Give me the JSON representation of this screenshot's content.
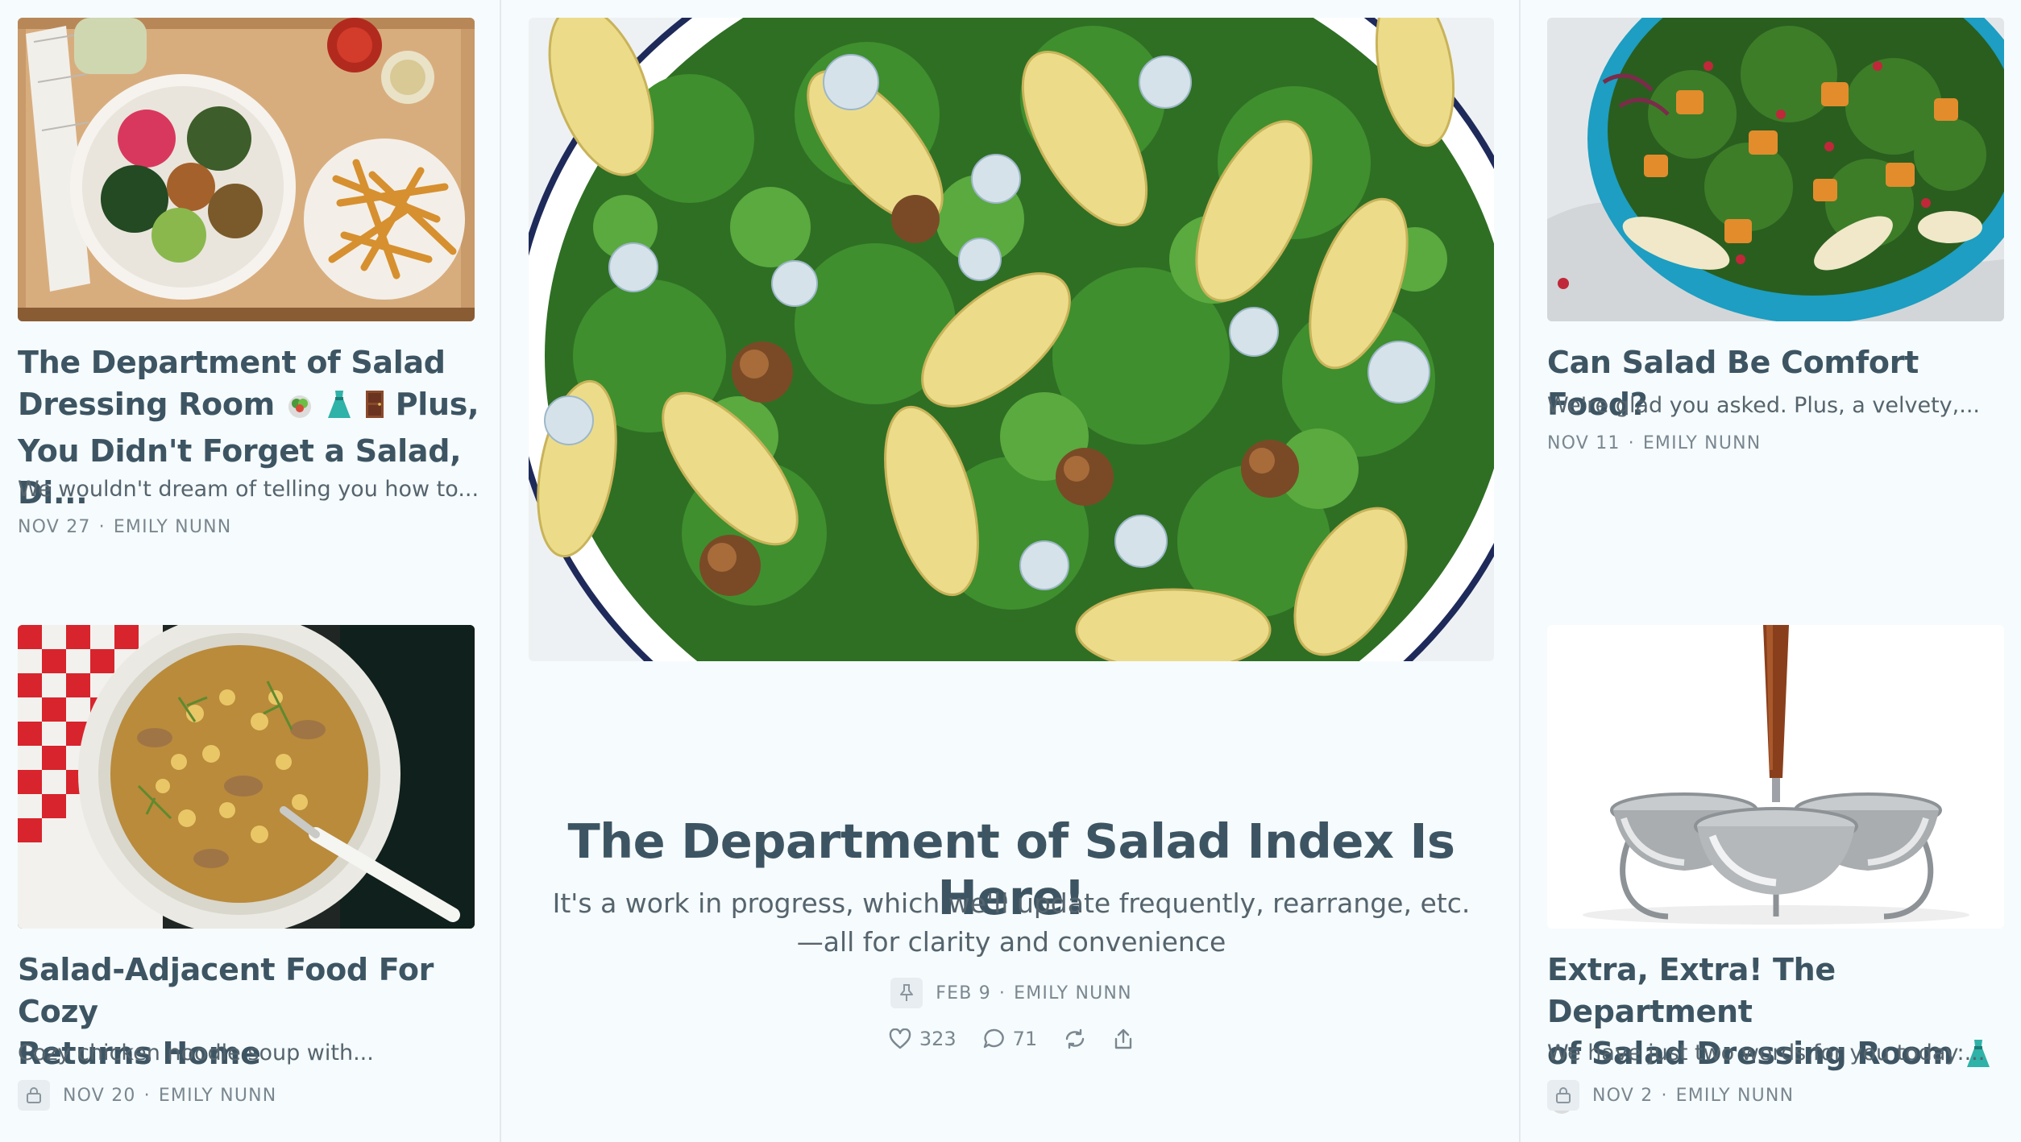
{
  "colors": {
    "background": "#f6fbfd",
    "title": "#3d5563",
    "text": "#55646d",
    "meta": "#7a8790",
    "divider": "#e3eaee"
  },
  "posts": {
    "top_left": {
      "title_line1": "The Department of Salad",
      "title_line2_text": "Dressing Room",
      "title_line2_suffix": "Plus,",
      "title_line3": "You Didn't Forget a Salad, Di...",
      "subtitle": "We wouldn't dream of telling you how to...",
      "date": "NOV 27",
      "author": "EMILY NUNN",
      "image_icon": "salad-bowl-with-fries-photo"
    },
    "bottom_left": {
      "title_line1": "Salad-Adjacent Food For Cozy",
      "title_line2": "Returns Home",
      "subtitle": "Cozy chicken noodle soup with...",
      "date": "NOV 20",
      "author": "EMILY NUNN",
      "locked": true,
      "image_icon": "chicken-noodle-soup-photo"
    },
    "featured": {
      "title": "The Department of Salad Index Is Here!",
      "subtitle": "It's a work in progress, which we'll update frequently, rearrange, etc.—all for clarity and convenience",
      "date": "FEB 9",
      "author": "EMILY NUNN",
      "pinned": true,
      "likes": "323",
      "comments": "71",
      "image_icon": "pear-arugula-salad-photo"
    },
    "top_right": {
      "title": "Can Salad Be Comfort Food?",
      "subtitle": "We're glad you asked. Plus, a velvety,...",
      "date": "NOV 11",
      "author": "EMILY NUNN",
      "image_icon": "squash-greens-salad-photo"
    },
    "bottom_right": {
      "title_line1": "Extra, Extra! The Department",
      "title_line2_text": "of Salad Dressing Room",
      "subtitle": "We have just two words for you today:...",
      "date": "NOV 2",
      "author": "EMILY NUNN",
      "locked": true,
      "image_icon": "condiment-caddy-photo"
    }
  },
  "separator": "·"
}
